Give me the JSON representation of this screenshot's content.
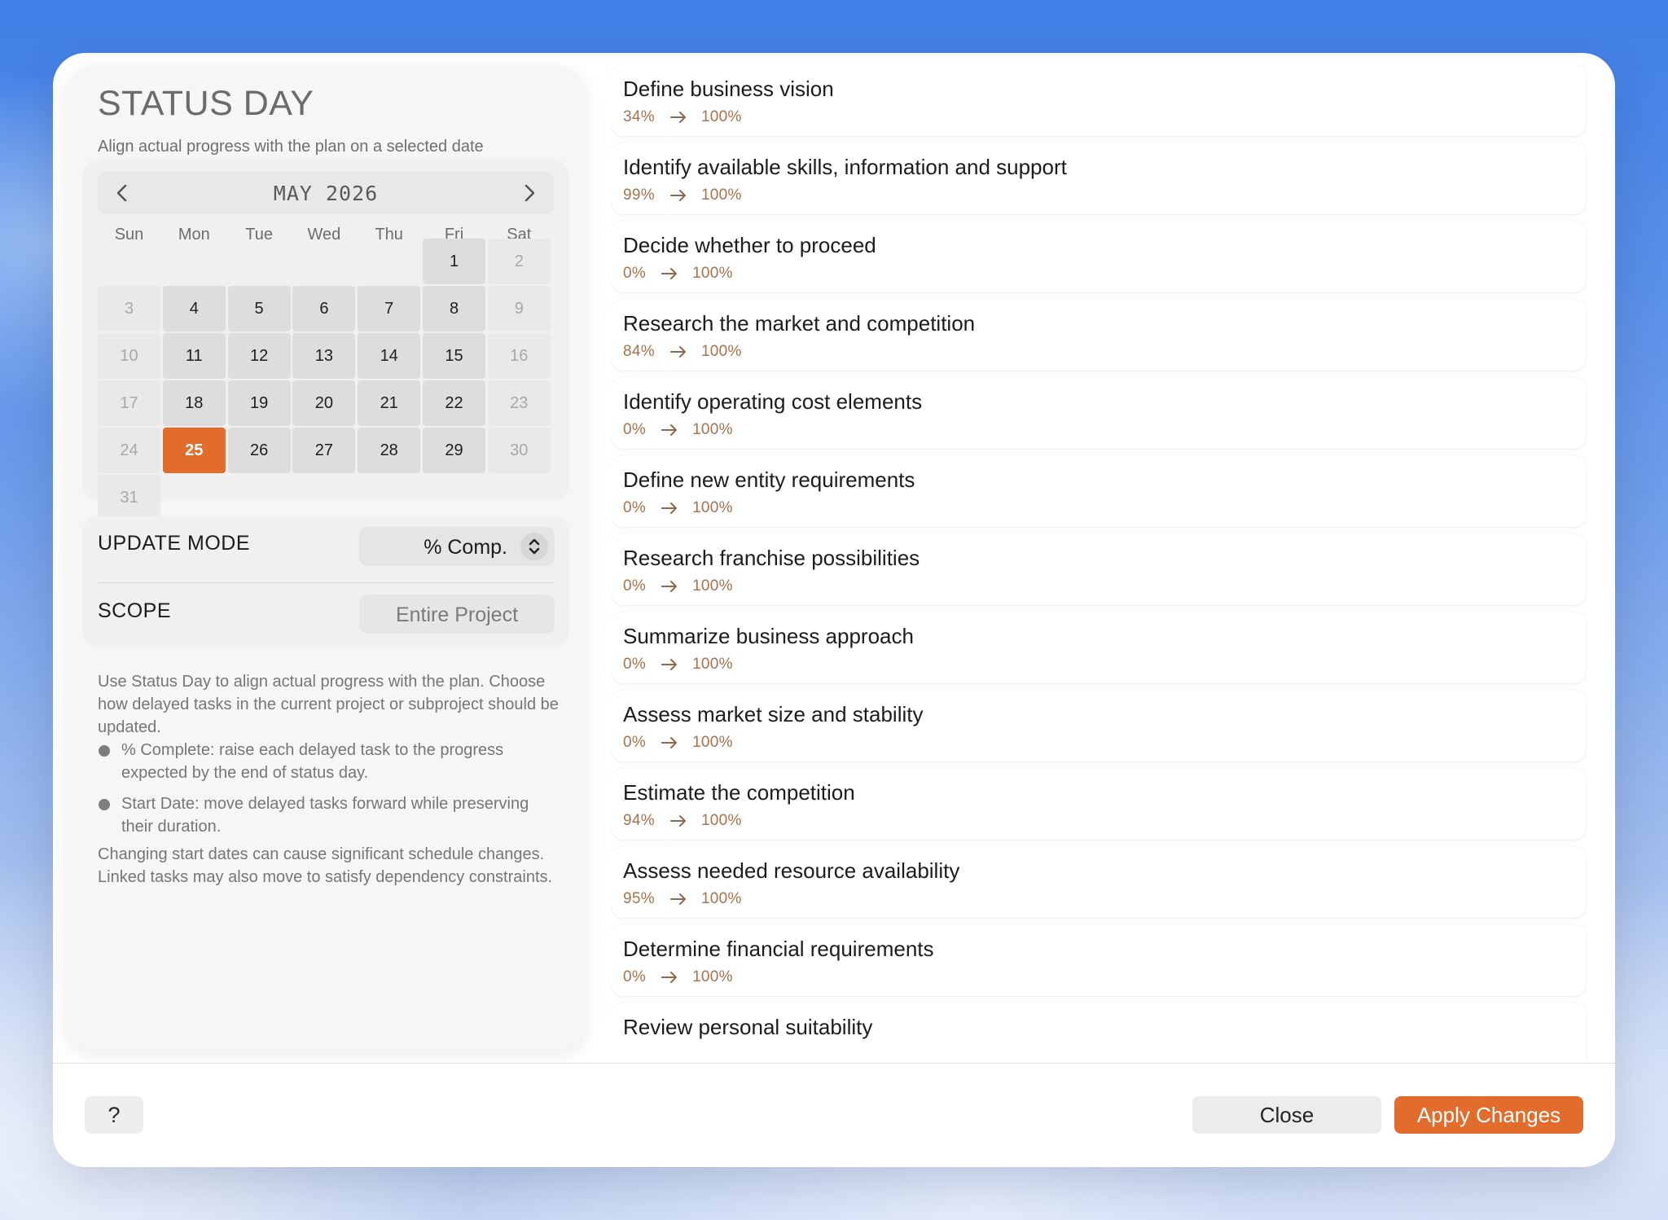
{
  "header": {
    "title": "STATUS DAY",
    "subtitle": "Align actual progress with the plan on a selected date"
  },
  "calendar": {
    "month_label": "MAY 2026",
    "weekdays": [
      "Sun",
      "Mon",
      "Tue",
      "Wed",
      "Thu",
      "Fri",
      "Sat"
    ],
    "first_weekday_index": 5,
    "days_in_month": 31,
    "selected_day": 25
  },
  "update_mode": {
    "label": "UPDATE MODE",
    "value": "% Comp."
  },
  "scope": {
    "label": "SCOPE",
    "value": "Entire Project"
  },
  "help": {
    "intro": "Use Status Day to align actual progress with the plan. Choose how delayed tasks in the current project or subproject should be updated.",
    "bullets": [
      "% Complete: raise each delayed task to the progress expected by the end of status day.",
      "Start Date: move delayed tasks forward while preserving their duration."
    ],
    "note": "Changing start dates can cause significant schedule changes. Linked tasks may also move to satisfy dependency constraints."
  },
  "tasks": [
    {
      "name": "Define business vision",
      "from": "34%",
      "to": "100%"
    },
    {
      "name": "Identify available skills, information and support",
      "from": "99%",
      "to": "100%"
    },
    {
      "name": "Decide whether to proceed",
      "from": "0%",
      "to": "100%"
    },
    {
      "name": "Research the market and competition",
      "from": "84%",
      "to": "100%"
    },
    {
      "name": "Identify operating cost elements",
      "from": "0%",
      "to": "100%"
    },
    {
      "name": "Define new entity requirements",
      "from": "0%",
      "to": "100%"
    },
    {
      "name": "Research franchise possibilities",
      "from": "0%",
      "to": "100%"
    },
    {
      "name": "Summarize business approach",
      "from": "0%",
      "to": "100%"
    },
    {
      "name": "Assess market size and stability",
      "from": "0%",
      "to": "100%"
    },
    {
      "name": "Estimate the competition",
      "from": "94%",
      "to": "100%"
    },
    {
      "name": "Assess needed resource availability",
      "from": "95%",
      "to": "100%"
    },
    {
      "name": "Determine financial requirements",
      "from": "0%",
      "to": "100%"
    },
    {
      "name": "Review personal suitability",
      "from": "",
      "to": ""
    }
  ],
  "footer": {
    "help_label": "?",
    "close_label": "Close",
    "apply_label": "Apply Changes"
  },
  "colors": {
    "accent": "#e16c2c",
    "progress_text": "#a3734c"
  },
  "icons": {
    "prev": "chevron-left-icon",
    "next": "chevron-right-icon",
    "select": "up-down-chevron-icon",
    "arrow": "arrow-right-icon"
  }
}
